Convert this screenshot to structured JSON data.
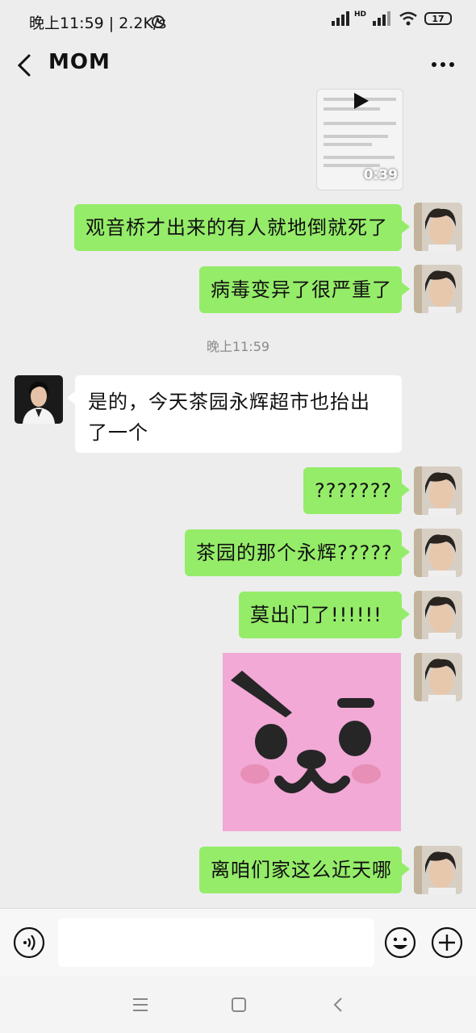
{
  "status_bar": {
    "time": "晚上11:59 | 2.2K/s",
    "battery": "17",
    "network_badge": "HD"
  },
  "header": {
    "title": "MOM"
  },
  "chat": {
    "video": {
      "duration": "0:39"
    },
    "messages": [
      {
        "sender": "me",
        "text": "观音桥才出来的有人就地倒就死了"
      },
      {
        "sender": "me",
        "text": "病毒变异了很严重了"
      },
      {
        "sender": "mom",
        "text": "是的，今天茶园永辉超市也抬出了一个"
      },
      {
        "sender": "me",
        "text": "???????"
      },
      {
        "sender": "me",
        "text": "茶园的那个永辉?????"
      },
      {
        "sender": "me",
        "text": "莫出门了!!!!!!"
      },
      {
        "sender": "me",
        "text": "离咱们家这么近天哪"
      }
    ],
    "timestamp": "晚上11:59"
  },
  "input_bar": {
    "placeholder": ""
  },
  "colors": {
    "my_bubble": "#95ec69",
    "their_bubble": "#ffffff",
    "background": "#ededed",
    "sticker_bg": "#f2a9d6"
  },
  "icons": [
    "back-icon",
    "more-icon",
    "voice-icon",
    "emoji-icon",
    "plus-icon",
    "menu-icon",
    "home-icon",
    "nav-back-icon",
    "alarm-icon",
    "signal-icon",
    "wifi-icon",
    "play-icon"
  ]
}
